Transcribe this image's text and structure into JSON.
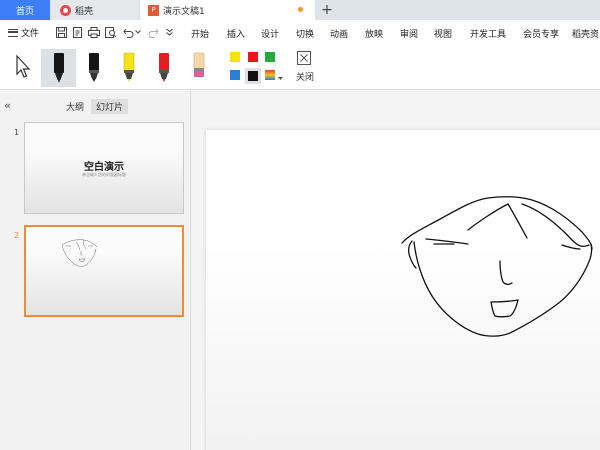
{
  "tabs": {
    "home": "首页",
    "daoke": "稻壳",
    "doc": "演示文稿1",
    "new_tab": "+"
  },
  "menu": {
    "file": "文件",
    "items": [
      "开始",
      "插入",
      "设计",
      "切换",
      "动画",
      "放映",
      "审阅",
      "视图",
      "开发工具",
      "会员专享",
      "稻壳资"
    ]
  },
  "ribbon": {
    "close_label": "关闭",
    "pens": [
      {
        "name": "arrow-pointer",
        "color": "#333333"
      },
      {
        "name": "ballpoint-pen",
        "color": "#111111"
      },
      {
        "name": "watercolor-pen",
        "color": "#111111"
      },
      {
        "name": "highlighter",
        "color": "#f5e21b"
      },
      {
        "name": "marker",
        "color": "#e02020"
      },
      {
        "name": "eraser",
        "color": "#d9639b"
      }
    ],
    "colors": [
      "#f7e017",
      "#e41b1b",
      "#27a83a",
      "#2a7fd4",
      "#111111"
    ]
  },
  "panel": {
    "tab_outline": "大纲",
    "tab_slides": "幻灯片",
    "slides": [
      {
        "number": "1",
        "title": "空白演示",
        "subtitle": "单击输入您的封面副标题"
      },
      {
        "number": "2"
      }
    ]
  },
  "colors": {
    "accent_blue": "#3d7df6",
    "selected_slide_border": "#f08b39"
  }
}
